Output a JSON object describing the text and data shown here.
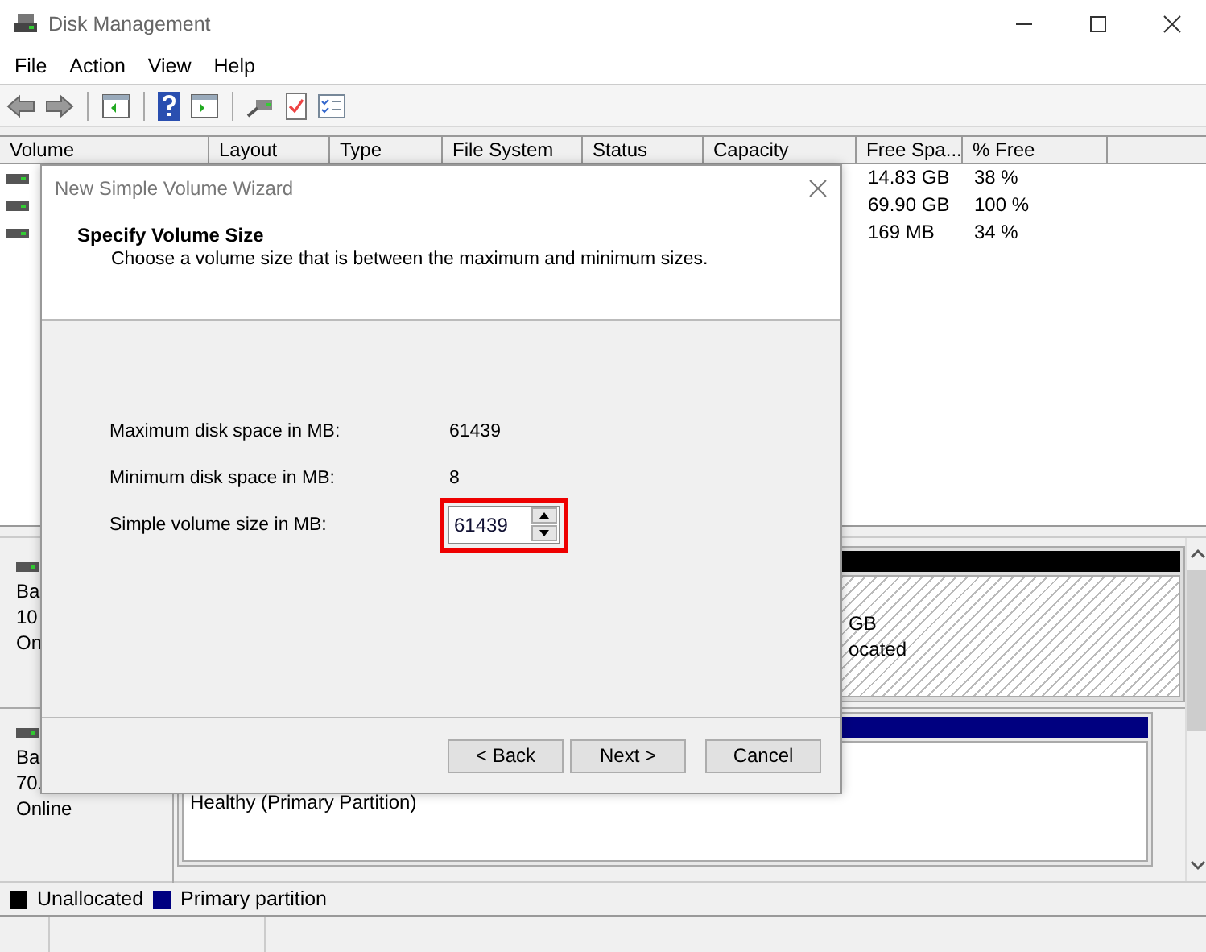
{
  "window": {
    "title": "Disk Management"
  },
  "menu": [
    "File",
    "Action",
    "View",
    "Help"
  ],
  "volume_list": {
    "columns": [
      "Volume",
      "Layout",
      "Type",
      "File System",
      "Status",
      "Capacity",
      "Free Spa...",
      "% Free"
    ],
    "rows": [
      {
        "free_space": "14.83 GB",
        "percent_free": "38 %"
      },
      {
        "free_space": "69.90 GB",
        "percent_free": "100 %"
      },
      {
        "free_space": "169 MB",
        "percent_free": "34 %"
      }
    ]
  },
  "disks": [
    {
      "info": [
        "Ba",
        "10",
        "On"
      ],
      "partition": {
        "kind": "unallocated",
        "lines": [
          "GB",
          "ocated"
        ]
      }
    },
    {
      "info": [
        "Ba",
        "70.",
        "Online"
      ],
      "partition": {
        "kind": "primary",
        "lines": [
          "Healthy (Primary Partition)"
        ]
      }
    }
  ],
  "legend": [
    {
      "label": "Unallocated",
      "color": "#000000"
    },
    {
      "label": "Primary partition",
      "color": "#000080"
    }
  ],
  "dialog": {
    "title": "New Simple Volume Wizard",
    "heading": "Specify Volume Size",
    "subheading": "Choose a volume size that is between the maximum and minimum sizes.",
    "fields": [
      {
        "kind": "readout",
        "label": "Maximum disk space in MB:",
        "value": "61439",
        "highlighted": false
      },
      {
        "kind": "readout",
        "label": "Minimum disk space in MB:",
        "value": "8",
        "highlighted": false
      },
      {
        "kind": "spinner",
        "label": "Simple volume size in MB:",
        "value": "61439",
        "highlighted": true
      }
    ],
    "buttons": [
      "< Back",
      "Next >",
      "Cancel"
    ]
  }
}
